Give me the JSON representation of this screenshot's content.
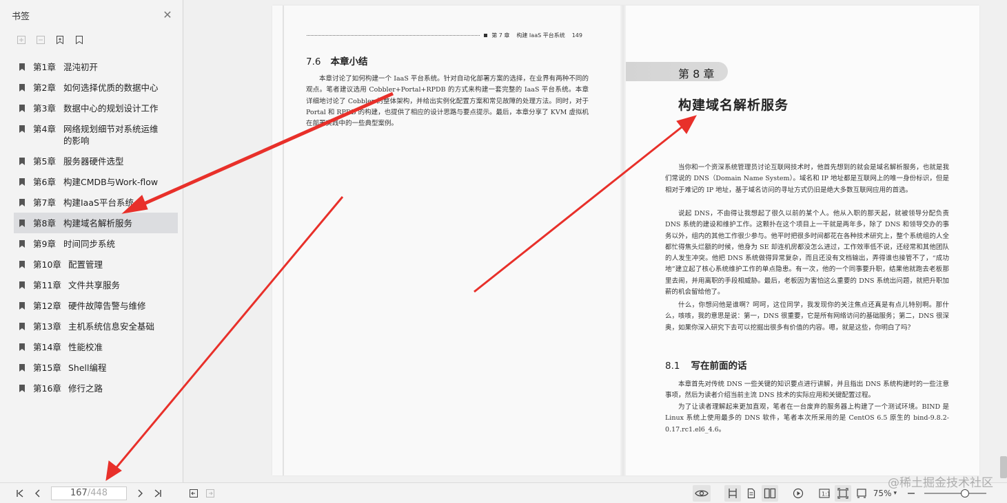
{
  "sidebar": {
    "title": "书签",
    "items": [
      {
        "chapter": "第1章",
        "title": "混沌初开"
      },
      {
        "chapter": "第2章",
        "title": "如何选择优质的数据中心"
      },
      {
        "chapter": "第3章",
        "title": "数据中心的规划设计工作"
      },
      {
        "chapter": "第4章",
        "title": "网络规划细节对系统运维的影响"
      },
      {
        "chapter": "第5章",
        "title": "服务器硬件选型"
      },
      {
        "chapter": "第6章",
        "title": "构建CMDB与Work-flow"
      },
      {
        "chapter": "第7章",
        "title": "构建IaaS平台系统"
      },
      {
        "chapter": "第8章",
        "title": "构建域名解析服务"
      },
      {
        "chapter": "第9章",
        "title": "时间同步系统"
      },
      {
        "chapter": "第10章",
        "title": "配置管理"
      },
      {
        "chapter": "第11章",
        "title": "文件共享服务"
      },
      {
        "chapter": "第12章",
        "title": "硬件故障告警与维修"
      },
      {
        "chapter": "第13章",
        "title": "主机系统信息安全基础"
      },
      {
        "chapter": "第14章",
        "title": "性能校准"
      },
      {
        "chapter": "第15章",
        "title": "Shell编程"
      },
      {
        "chapter": "第16章",
        "title": "修行之路"
      }
    ],
    "active_index": 7
  },
  "document": {
    "left_page": {
      "header_chapter": "第 7 章",
      "header_title": "构建 IaaS 平台系统",
      "header_page": "149",
      "section_num": "7.6",
      "section_title": "本章小结",
      "paragraph": "本章讨论了如何构建一个 IaaS 平台系统。针对自动化部署方案的选择，在业界有两种不同的观点。笔者建议选用 Cobbler+Portal+RPDB 的方式来构建一套完整的 IaaS 平台系统。本章详细地讨论了 Cobbler 的整体架构，并给出实例化配置方案和常见故障的处理方法。同时，对于 Portal 和 RPDB 的构建，也提供了相应的设计思路与要点提示。最后，本章分享了 KVM 虚拟机在部署实践中的一些典型案例。"
    },
    "right_page": {
      "chapter_label": "第 8 章",
      "chapter_title": "构建域名解析服务",
      "paragraphs": [
        "当你和一个资深系统管理员讨论互联网技术时，他首先想到的就会是域名解析服务，也就是我们常说的 DNS（Domain Name System）。域名和 IP 地址都是互联网上的唯一身份标识，但是相对于难记的 IP 地址，基于域名访问的寻址方式仍旧是绝大多数互联网应用的首选。",
        "说起 DNS，不由得让我想起了很久以前的某个人。他从入职的那天起，就被领导分配负责 DNS 系统的建设和维护工作。这颗扑在这个项目上一干就是两年多，除了 DNS 和领导交办的事务以外，组内的其他工作很少参与。他平时把很多时间都花在各种技术研究上，整个系统组的人全都忙得焦头烂额的时候，他身为 SE 却连机房都没怎么进过，工作效率低不说，还经常和其他团队的人发生冲突。他把 DNS 系统做得异常复杂，而且还没有文档输出，弄得谁也接管不了，“成功地”建立起了核心系统维护工作的单点隐患。有一次，他的一个同事要升职，结果他就跑去老板那里去闹，并用离职的手段相威胁。最后，老板因为害怕这么重要的 DNS 系统出问题，就把升职加薪的机会留给他了。",
        "什么，你想问他是谁啊？呵呵，这位同学，我发现你的关注焦点还真是有点儿特别啊。那什么，咳咳，我的意思是说：第一，DNS 很重要，它是所有网络访问的基础服务；第二，DNS 很深奥，如果你深入研究下去可以挖掘出很多有价值的内容。嗯，就是这些，你明白了吗？"
      ],
      "section_num": "8.1",
      "section_title": "写在前面的话",
      "section_paragraphs": [
        "本章首先对传统 DNS 一些关键的知识要点进行讲解，并且指出 DNS 系统构建时的一些注意事项，然后为读者介绍当前主流 DNS 技术的实际应用和关键配置过程。",
        "为了让读者理解起来更加直观，笔者在一台废弃的服务器上构建了一个测试环境。BIND 是 Linux 系统上使用最多的 DNS 软件，笔者本次所采用的是 CentOS 6.5 原生的 bind-9.8.2-0.17.rc1.el6_4.6。"
      ]
    }
  },
  "toolbar": {
    "current_page": "167",
    "total_pages": "/448",
    "zoom": "75%",
    "zoom_level": 0.75,
    "icons": [
      "first-page-icon",
      "prev-page-icon",
      "next-page-icon",
      "last-page-icon",
      "back-icon",
      "forward-icon",
      "eye-icon",
      "single-page-icon",
      "continuous-page-icon",
      "two-page-icon",
      "play-icon",
      "actual-size-icon",
      "fit-page-icon",
      "fit-width-icon",
      "zoom-out-icon"
    ]
  },
  "watermark": "@稀土掘金技术社区",
  "colors": {
    "arrow": "#e8302a",
    "active_bookmark_bg": "#dcdde0",
    "sidebar_bg": "#f3f3f3"
  }
}
